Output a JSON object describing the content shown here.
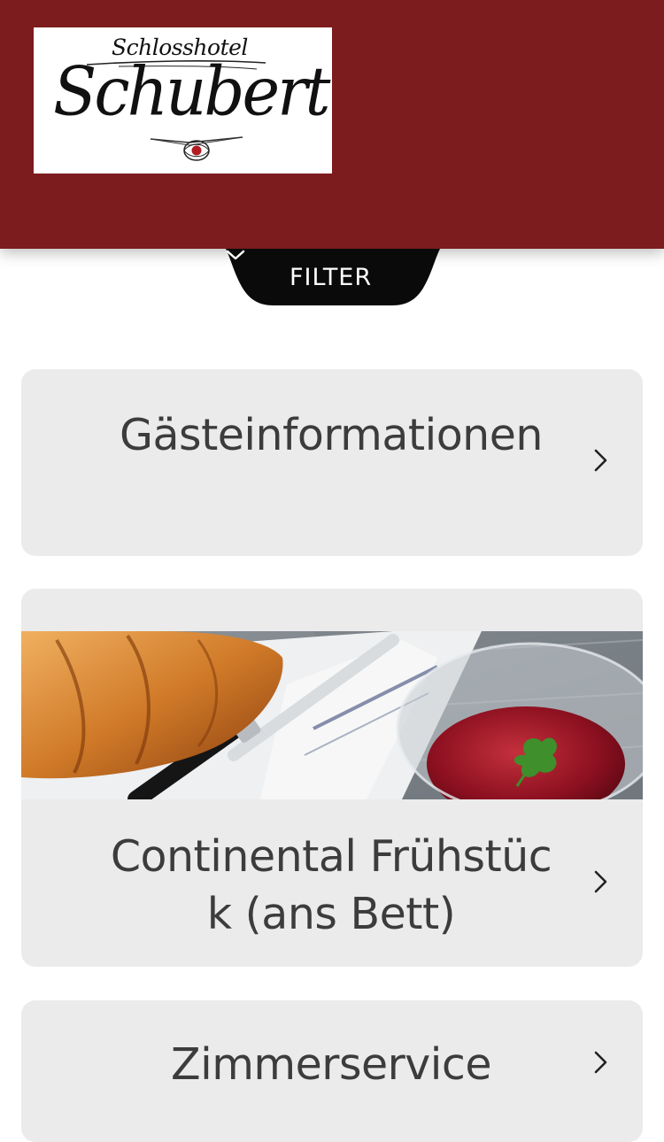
{
  "header": {
    "logo_sub": "Schlosshotel",
    "logo_main": "Schubert",
    "background_color": "#7c1c1e"
  },
  "filter": {
    "label": "FILTER",
    "icon": "chevron-down-icon"
  },
  "cards": [
    {
      "title": "Gästeinformationen",
      "icon": "chevron-right-icon"
    },
    {
      "title": "Continental Frühstück (ans Bett)",
      "image": "croissant-with-jam-photo",
      "icon": "chevron-right-icon"
    },
    {
      "title": "Zimmerservice",
      "icon": "chevron-right-icon"
    }
  ]
}
